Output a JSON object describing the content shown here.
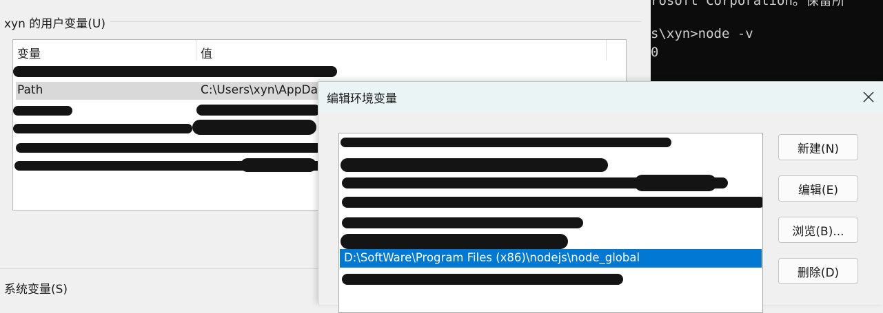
{
  "user_vars": {
    "group_label": "xyn 的用户变量(U)",
    "columns": {
      "variable": "变量",
      "value": "值"
    },
    "path_row": {
      "name": "Path",
      "value": "C:\\Users\\xyn\\AppDa"
    }
  },
  "system_vars": {
    "group_label": "系统变量(S)"
  },
  "console": {
    "line1": "rosoft Corporation。保留所",
    "line2": "s\\xyn>node -v",
    "line3": "0"
  },
  "dialog": {
    "title": "编辑环境变量",
    "selected_entry": "D:\\SoftWare\\Program Files (x86)\\nodejs\\node_global",
    "buttons": {
      "new": "新建(N)",
      "edit": "编辑(E)",
      "browse": "浏览(B)...",
      "delete": "删除(D)"
    }
  },
  "colors": {
    "selection": "#0078d4",
    "titlebar": "#eaf4f4",
    "console_bg": "#0c0c0c"
  }
}
